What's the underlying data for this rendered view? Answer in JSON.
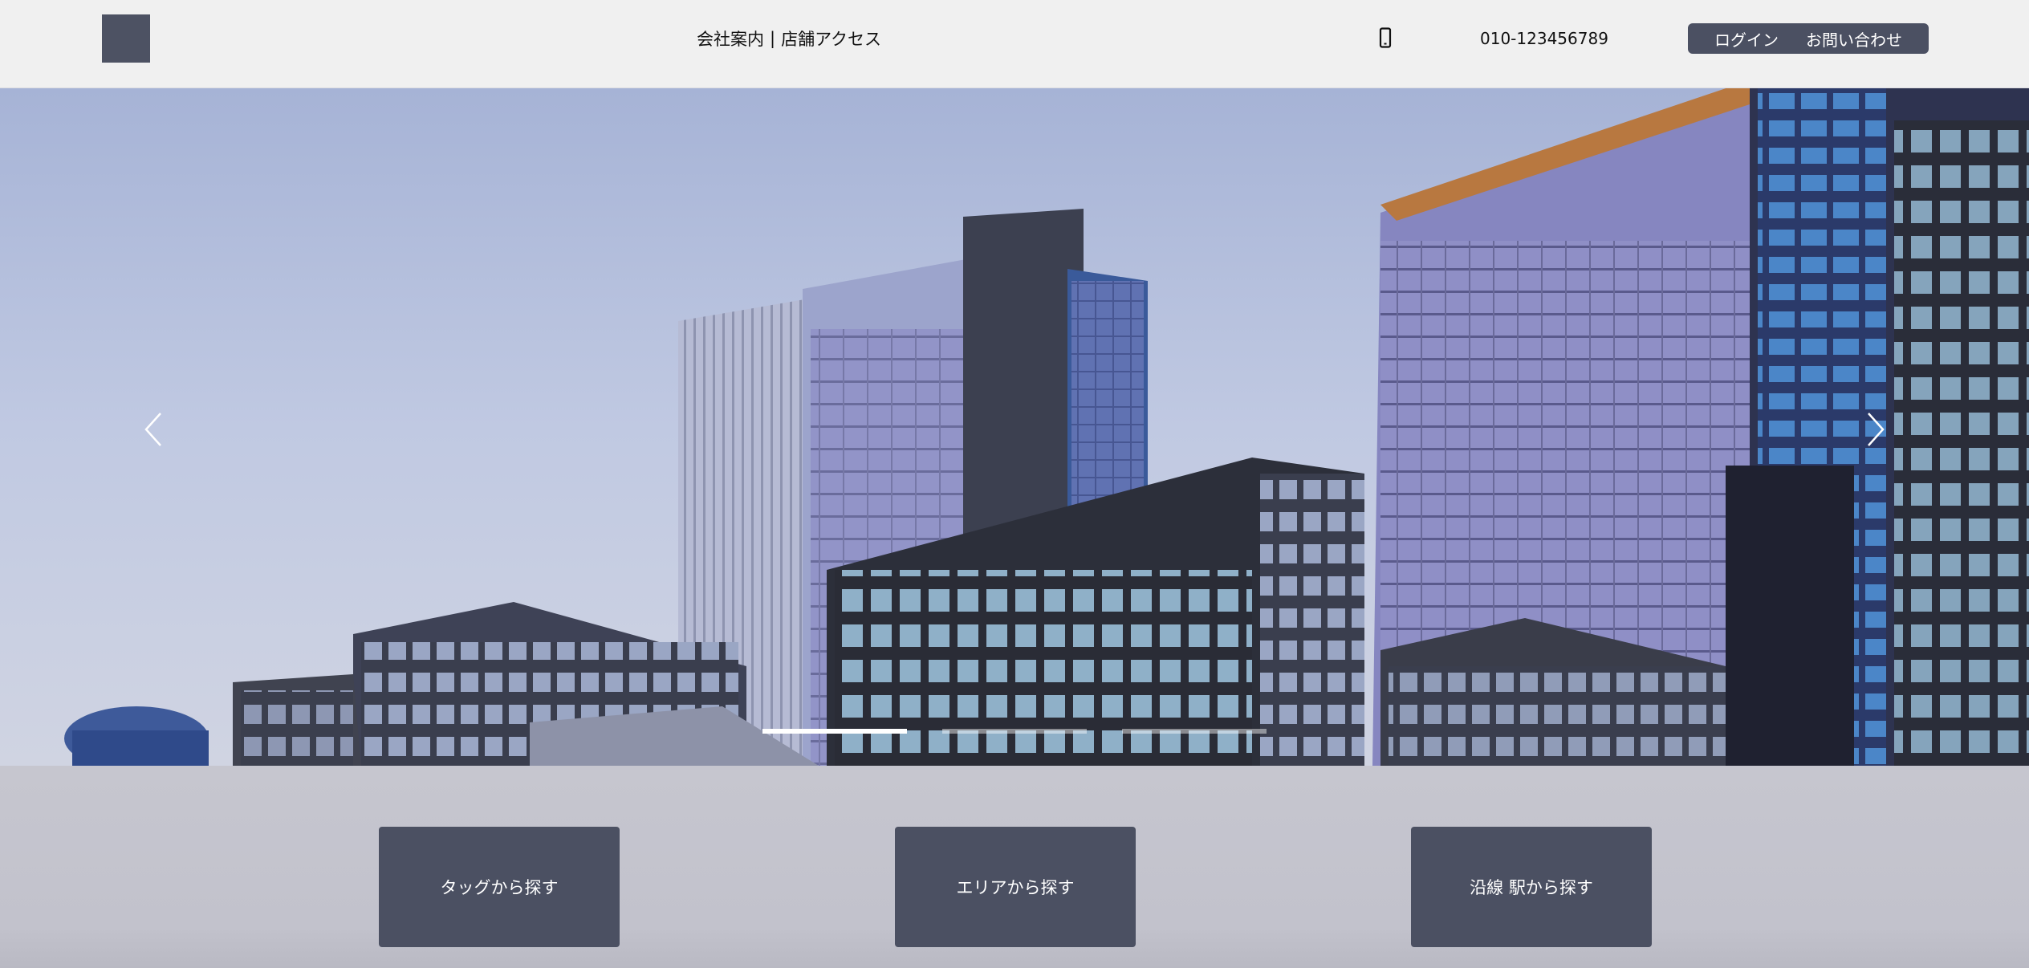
{
  "header": {
    "nav": [
      {
        "label": "会社案内"
      },
      {
        "label": "店舗アクセス"
      }
    ],
    "separator": "|",
    "phone_icon": "smartphone-icon",
    "phone_number": "010-123456789",
    "actions": [
      {
        "label": "ログイン"
      },
      {
        "label": "お問い合わせ"
      }
    ]
  },
  "hero": {
    "prev_icon": "chevron-left-icon",
    "next_icon": "chevron-right-icon",
    "slide_count": 3,
    "active_slide": 1
  },
  "search": {
    "buttons": [
      {
        "label": "タッグから探す"
      },
      {
        "label": "エリアから探す"
      },
      {
        "label": "沿線 駅から探す"
      }
    ]
  },
  "colors": {
    "header_bg": "#f0f0f0",
    "accent": "#4b5062",
    "section_bg": "#c4c4ce"
  }
}
